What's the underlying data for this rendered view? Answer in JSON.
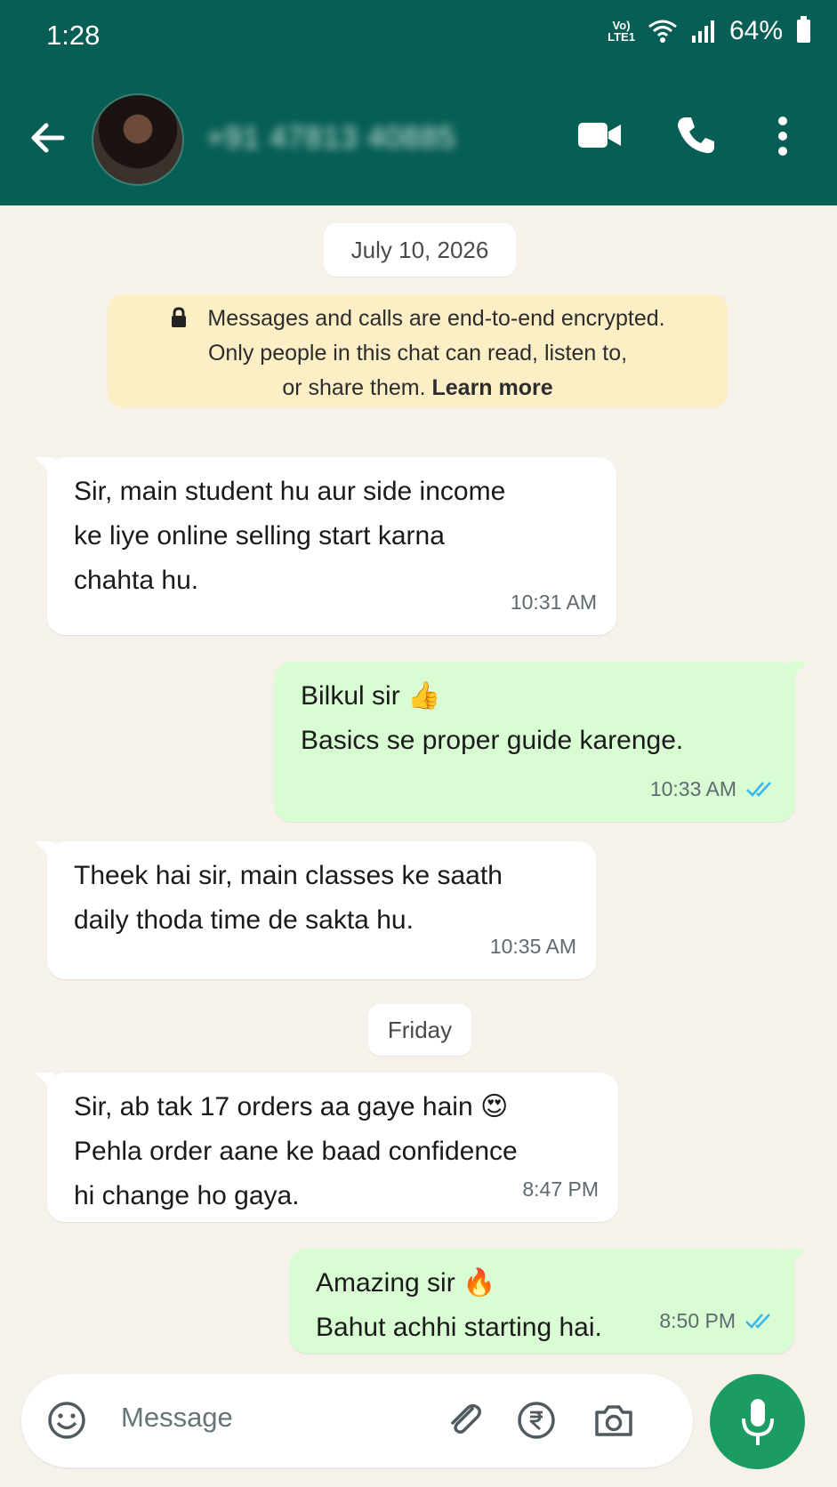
{
  "status_bar": {
    "time": "1:28",
    "network_label_top": "Vo)",
    "network_label_bottom": "LTE1",
    "battery": "64%"
  },
  "header": {
    "contact_name": "+91 47813 40885",
    "back_icon": "arrow-left-icon",
    "video_icon": "video-camera-icon",
    "call_icon": "phone-icon",
    "menu_icon": "more-vertical-icon"
  },
  "chat": {
    "date_1": "July 10, 2026",
    "encryption_line_1": "Messages and calls are end-to-end encrypted.",
    "encryption_line_2": "Only people in this chat can read, listen to,",
    "encryption_line_3": "or share them.",
    "encryption_link": "Learn more",
    "messages": [
      {
        "direction": "incoming",
        "lines": [
          "Sir, main student hu aur side income",
          "ke liye online selling start karna",
          "chahta hu."
        ],
        "time": "10:31 AM"
      },
      {
        "direction": "outgoing",
        "lines": [
          "Bilkul sir",
          "Basics se proper guide karenge."
        ],
        "emoji": "👍",
        "time": "10:33 AM",
        "status": "read"
      },
      {
        "direction": "incoming",
        "lines": [
          "Theek hai sir, main classes ke saath",
          "daily thoda time de sakta hu."
        ],
        "time": "10:35 AM"
      },
      {
        "direction": "incoming",
        "lines": [
          "Sir, ab tak 17 orders aa gaye hain",
          "Pehla order aane ke baad confidence",
          "hi change ho gaya."
        ],
        "emoji": "😍",
        "time": "8:47 PM"
      },
      {
        "direction": "outgoing",
        "lines": [
          "Amazing sir",
          "Bahut achhi starting hai."
        ],
        "emoji": "🔥",
        "time": "8:50 PM",
        "status": "read"
      }
    ],
    "date_2": "Friday"
  },
  "composer": {
    "placeholder": "Message",
    "emoji_icon": "smiley-icon",
    "attach_icon": "paperclip-icon",
    "payment_icon": "rupee-icon",
    "camera_icon": "camera-icon",
    "mic_icon": "microphone-icon"
  },
  "colors": {
    "header": "#075e54",
    "chat_background": "#f6f1ea",
    "incoming_bubble": "#ffffff",
    "outgoing_bubble": "#d9fdd3",
    "encryption_notice": "#fcefc6",
    "mic_button": "#1b9c62",
    "read_ticks": "#34b7f1"
  }
}
